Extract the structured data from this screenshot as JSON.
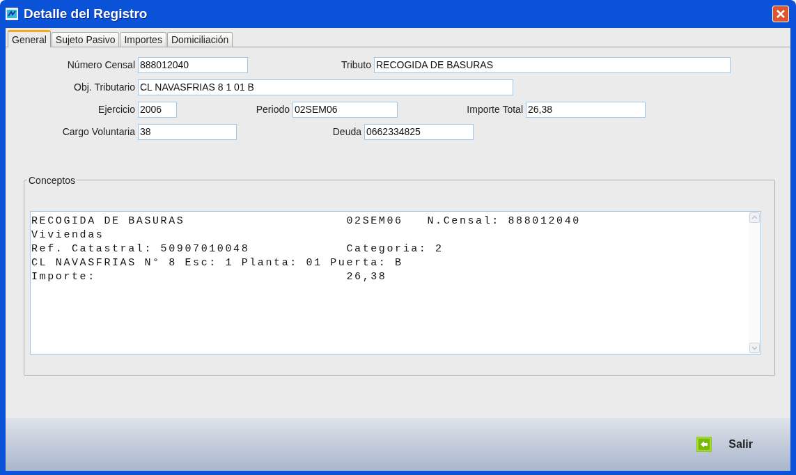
{
  "window": {
    "title": "Detalle del Registro"
  },
  "tabs": [
    {
      "label": "General",
      "selected": true
    },
    {
      "label": "Sujeto Pasivo",
      "selected": false
    },
    {
      "label": "Importes",
      "selected": false
    },
    {
      "label": "Domiciliación",
      "selected": false
    }
  ],
  "fields": [
    [
      {
        "label": "Número Censal",
        "value": "888012040"
      },
      {
        "label": "Tributo",
        "value": "RECOGIDA DE BASURAS"
      }
    ],
    [
      {
        "label": "Obj. Tributario",
        "value": "CL NAVASFRIAS 8 1 01 B"
      }
    ],
    [
      {
        "label": "Ejercicio",
        "value": "2006"
      },
      {
        "label": "Periodo",
        "value": "02SEM06"
      },
      {
        "label": "Importe Total",
        "value": "26,38"
      }
    ],
    [
      {
        "label": "Cargo Voluntaria",
        "value": "38"
      },
      {
        "label": "Deuda",
        "value": "0662334825"
      }
    ]
  ],
  "conceptos": {
    "title": "Conceptos",
    "lines": [
      "RECOGIDA DE BASURAS                    02SEM06   N.Censal: 888012040",
      "Viviendas",
      "Ref. Catastral: 50907010048            Categoria: 2",
      "CL NAVASFRIAS N° 8 Esc: 1 Planta: 01 Puerta: B",
      "Importe:                               26,38"
    ]
  },
  "exit_button": {
    "label": "Salir"
  }
}
